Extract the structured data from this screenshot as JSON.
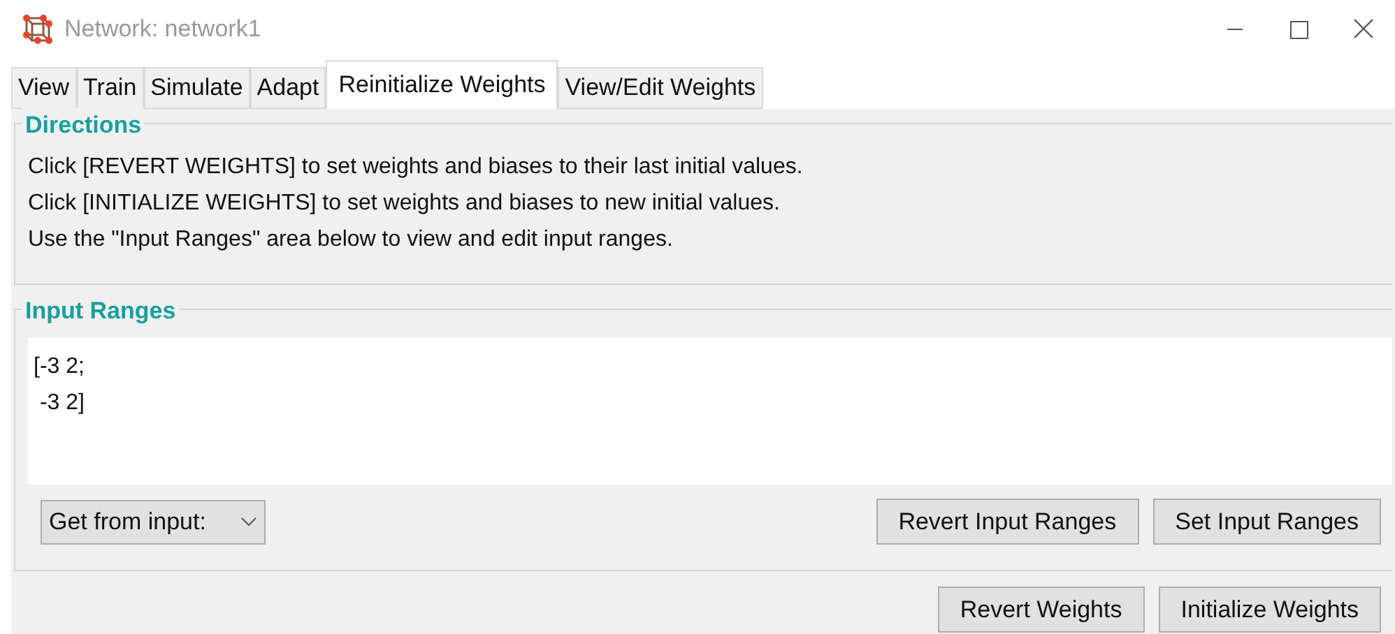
{
  "window": {
    "title": "Network: network1"
  },
  "tabs": [
    {
      "label": "View",
      "selected": false
    },
    {
      "label": "Train",
      "selected": false
    },
    {
      "label": "Simulate",
      "selected": false
    },
    {
      "label": "Adapt",
      "selected": false
    },
    {
      "label": "Reinitialize Weights",
      "selected": true
    },
    {
      "label": "View/Edit Weights",
      "selected": false
    }
  ],
  "directions": {
    "title": "Directions",
    "lines": [
      "Click [REVERT WEIGHTS] to set weights and biases to their last initial values.",
      "Click [INITIALIZE WEIGHTS] to set weights and biases to new initial values.",
      "Use the \"Input Ranges\" area below to view and edit input ranges."
    ]
  },
  "input_ranges": {
    "title": "Input Ranges",
    "value": "[-3 2;\n -3 2]",
    "dropdown": "Get from input:",
    "buttons": [
      "Revert Input Ranges",
      "Set Input Ranges"
    ]
  },
  "buttons": [
    "Revert Weights",
    "Initialize Weights"
  ]
}
